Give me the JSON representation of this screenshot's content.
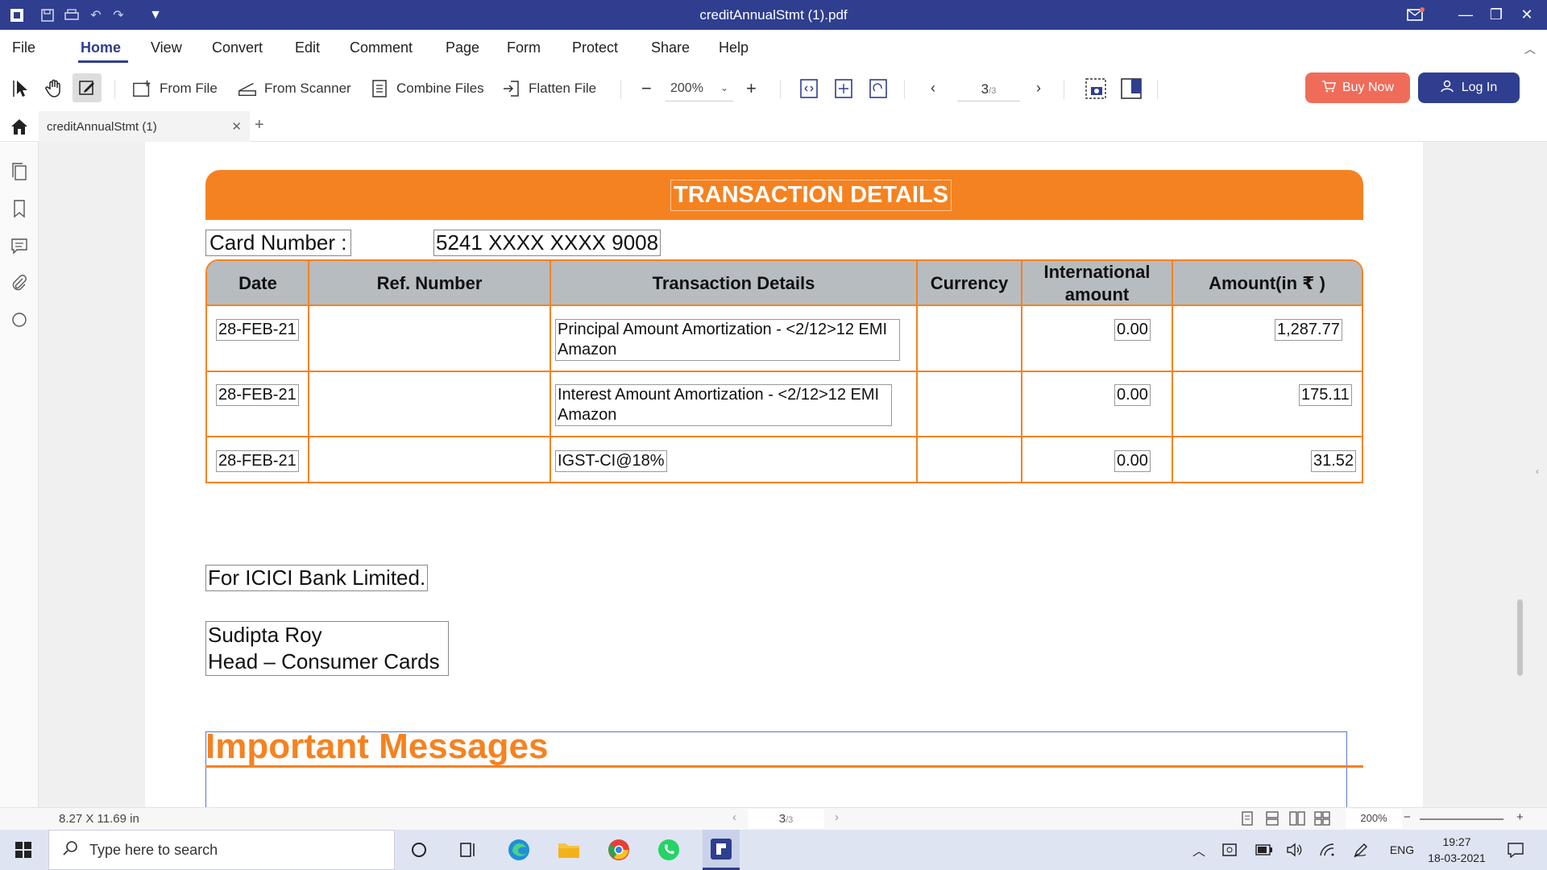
{
  "app": {
    "window_title": "creditAnnualStmt (1).pdf"
  },
  "menu": {
    "file": "File",
    "items": [
      "Home",
      "View",
      "Convert",
      "Edit",
      "Comment",
      "Page",
      "Form",
      "Protect",
      "Share",
      "Help"
    ],
    "active": "Home"
  },
  "toolbar": {
    "from_file": "From File",
    "from_scanner": "From Scanner",
    "combine_files": "Combine Files",
    "flatten_file": "Flatten File",
    "zoom_value": "200%",
    "page_current": "3",
    "page_total": "/3",
    "buy_now": "Buy Now",
    "log_in": "Log In"
  },
  "tab": {
    "name": "creditAnnualStmt (1)"
  },
  "document": {
    "banner_title": "TRANSACTION DETAILS",
    "card_number_label": "Card Number :",
    "card_number_value": "5241 XXXX XXXX 9008",
    "columns": [
      "Date",
      "Ref. Number",
      "Transaction Details",
      "Currency",
      "International amount",
      "Amount(in ₹ )"
    ],
    "rows": [
      {
        "date": "28-FEB-21",
        "ref": "",
        "details": "Principal Amount Amortization - <2/12>12 EMI Amazon",
        "currency": "",
        "intl_amount": "0.00",
        "amount": "1,287.77"
      },
      {
        "date": "28-FEB-21",
        "ref": "",
        "details": "Interest Amount Amortization - <2/12>12 EMI Amazon",
        "currency": "",
        "intl_amount": "0.00",
        "amount": "175.11"
      },
      {
        "date": "28-FEB-21",
        "ref": "",
        "details": "IGST-CI@18%",
        "currency": "",
        "intl_amount": "0.00",
        "amount": "31.52"
      }
    ],
    "bank_line": "For ICICI Bank Limited.",
    "signatory_name": "Sudipta Roy",
    "signatory_title": "Head – Consumer Cards",
    "important_messages": "Important Messages"
  },
  "statusbar": {
    "page_size": "8.27 X 11.69 in",
    "page_current": "3",
    "page_total": "/3",
    "zoom": "200%"
  },
  "taskbar": {
    "search_placeholder": "Type here to search",
    "language": "ENG",
    "time": "19:27",
    "date": "18-03-2021"
  },
  "colors": {
    "brand": "#2f3e8f",
    "accent_orange": "#f58220",
    "buy_button": "#f06c5a",
    "header_gray": "#b7bcc0"
  }
}
